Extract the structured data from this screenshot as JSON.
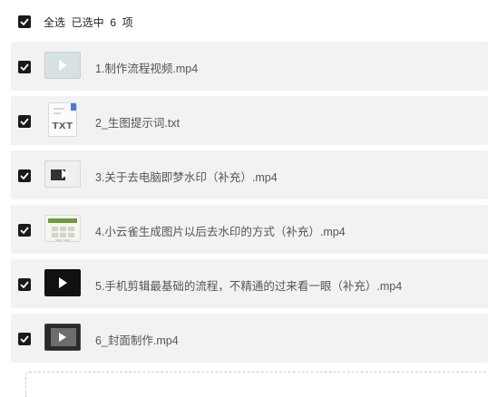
{
  "select_all": {
    "label": "全选  已选中  6  项",
    "checked": true
  },
  "files": [
    {
      "name": "1.制作流程视频.mp4",
      "checked": true,
      "thumb": "video-thumbnail"
    },
    {
      "name": "2_生图提示词.txt",
      "checked": true,
      "thumb": "txt-file-icon",
      "thumb_label": "TXT"
    },
    {
      "name": "3.关于去电脑即梦水印（补充）.mp4",
      "checked": true,
      "thumb": "video-thumbnail"
    },
    {
      "name": "4.小云雀生成图片以后去水印的方式（补充）.mp4",
      "checked": true,
      "thumb": "video-thumbnail"
    },
    {
      "name": "5.手机剪辑最基础的流程，不精通的过来看一眼（补充）.mp4",
      "checked": true,
      "thumb": "video-thumbnail"
    },
    {
      "name": "6_封面制作.mp4",
      "checked": true,
      "thumb": "video-thumbnail"
    }
  ],
  "colors": {
    "checkbox": "#1a1a1a",
    "row_background": "#f2f2f2",
    "dropzone_border": "#c9cce0"
  }
}
